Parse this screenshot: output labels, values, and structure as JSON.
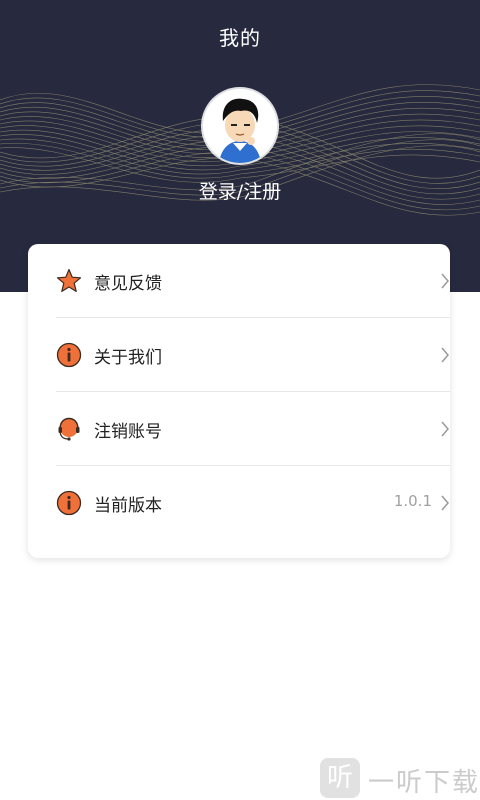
{
  "header": {
    "title": "我的",
    "login_label": "登录/注册"
  },
  "menu": [
    {
      "label": "意见反馈",
      "icon": "star-icon",
      "value": ""
    },
    {
      "label": "关于我们",
      "icon": "info-icon",
      "value": ""
    },
    {
      "label": "注销账号",
      "icon": "headset-icon",
      "value": ""
    },
    {
      "label": "当前版本",
      "icon": "info-icon",
      "value": "1.0.1"
    }
  ],
  "watermark": {
    "badge": "听",
    "text": "一听下载"
  },
  "colors": {
    "header_bg": "#272a3e",
    "icon_accent": "#f0703a",
    "wave": "#c8c08a"
  }
}
